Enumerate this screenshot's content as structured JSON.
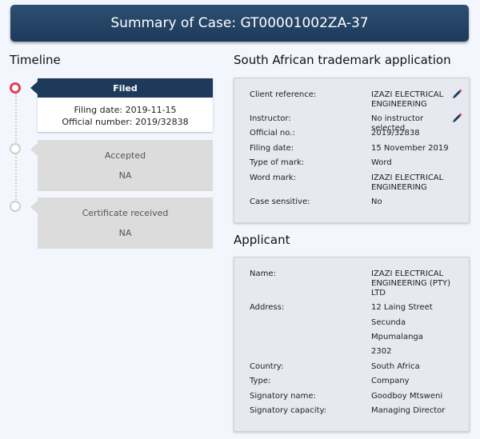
{
  "header": {
    "title": "Summary of Case: GT00001002ZA-37"
  },
  "timeline": {
    "title": "Timeline",
    "items": [
      {
        "status": "Filed",
        "lines": [
          "Filing date: 2019-11-15",
          "Official number: 2019/32838"
        ]
      },
      {
        "status": "Accepted",
        "value": "NA"
      },
      {
        "status": "Certificate received",
        "value": "NA"
      }
    ]
  },
  "trademark": {
    "title": "South African trademark application",
    "rows": [
      {
        "label": "Client reference:",
        "value": "IZAZI ELECTRICAL ENGINEERING"
      },
      {
        "label": "Instructor:",
        "value": "No instructor selected"
      },
      {
        "label": "Official no.:",
        "value": "2019/32838"
      },
      {
        "label": "Filing date:",
        "value": "15 November 2019"
      },
      {
        "label": "Type of mark:",
        "value": "Word"
      },
      {
        "label": "Word mark:",
        "value": "IZAZI ELECTRICAL ENGINEERING"
      },
      {
        "label": "Case sensitive:",
        "value": "No"
      }
    ]
  },
  "applicant": {
    "title": "Applicant",
    "rows": [
      {
        "label": "Name:",
        "value": "IZAZI ELECTRICAL ENGINEERING (PTY) LTD"
      },
      {
        "label": "Address:",
        "value": "12 Laing Street"
      },
      {
        "label": "",
        "value": "Secunda"
      },
      {
        "label": "",
        "value": "Mpumalanga"
      },
      {
        "label": "",
        "value": "2302"
      },
      {
        "label": "Country:",
        "value": "South Africa"
      },
      {
        "label": "Type:",
        "value": "Company"
      },
      {
        "label": "Signatory name:",
        "value": "Goodboy Mtsweni"
      },
      {
        "label": "Signatory capacity:",
        "value": "Managing Director"
      }
    ]
  },
  "icons": {
    "edit": "pencil-icon"
  },
  "colors": {
    "header": "#1d3a5b",
    "active_node": "#e0405a",
    "panel": "#e6e9ef"
  }
}
